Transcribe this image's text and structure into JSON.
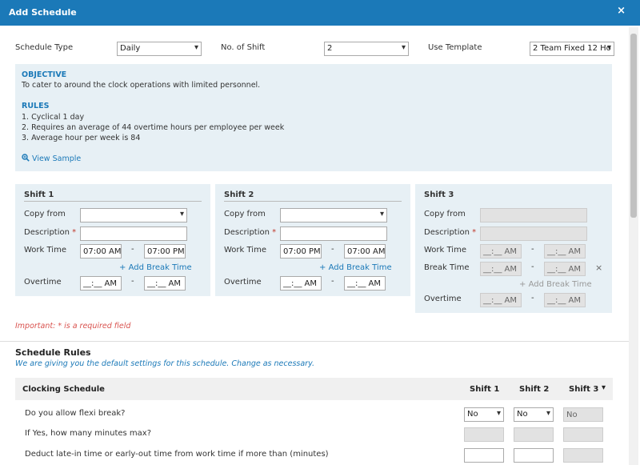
{
  "dialog": {
    "title": "Add Schedule",
    "close": "×"
  },
  "top_form": {
    "schedule_type_label": "Schedule Type",
    "schedule_type_value": "Daily",
    "no_of_shift_label": "No. of Shift",
    "no_of_shift_value": "2",
    "use_template_label": "Use Template",
    "use_template_value": "2 Team Fixed 12 Ho"
  },
  "info": {
    "objective_heading": "OBJECTIVE",
    "objective_text": "To cater to around the clock operations with limited personnel.",
    "rules_heading": "RULES",
    "rules": [
      "1. Cyclical 1 day",
      "2. Requires an average of 44 overtime hours per employee per week",
      "3. Average hour per week is 84"
    ],
    "view_sample": "View Sample"
  },
  "shift_labels": {
    "copy_from": "Copy from",
    "description": "Description",
    "required_mark": "*",
    "work_time": "Work Time",
    "break_time": "Break Time",
    "overtime": "Overtime",
    "add_break_time": "Add Break Time",
    "plus": "+",
    "dash": "-"
  },
  "shifts": [
    {
      "title": "Shift 1",
      "copy_from": "",
      "description": "",
      "work_start": "07:00 AM",
      "work_end": "07:00 PM",
      "ot_start": "__:__ AM",
      "ot_end": "__:__ AM"
    },
    {
      "title": "Shift 2",
      "copy_from": "",
      "description": "",
      "work_start": "07:00 PM",
      "work_end": "07:00 AM",
      "ot_start": "__:__ AM",
      "ot_end": "__:__ AM"
    },
    {
      "title": "Shift 3",
      "copy_from": "",
      "description": "",
      "work_start": "__:__ AM",
      "work_end": "__:__ AM",
      "break_start": "__:__ AM",
      "break_end": "__:__ AM",
      "remove": "×",
      "ot_start": "__:__ AM",
      "ot_end": "__:__ AM"
    }
  ],
  "important_note": "Important: * is a required field",
  "schedule_rules": {
    "title": "Schedule Rules",
    "subtitle": "We are giving you the default settings for this schedule. Change as necessary.",
    "table_heading": "Clocking Schedule",
    "columns": [
      "Shift 1",
      "Shift 2",
      "Shift 3"
    ],
    "caret": "▾",
    "rows": [
      {
        "question": "Do you allow flexi break?",
        "values": [
          "No",
          "No",
          "No"
        ]
      },
      {
        "question": "If Yes, how many minutes max?",
        "values": [
          "",
          "",
          ""
        ]
      },
      {
        "question": "Deduct late-in time or early-out time from work time if more than (minutes)",
        "values": [
          "",
          "",
          ""
        ]
      }
    ]
  },
  "colors": {
    "accent": "#1b79b8",
    "panel": "#e7f0f5",
    "required": "#d9534f"
  }
}
